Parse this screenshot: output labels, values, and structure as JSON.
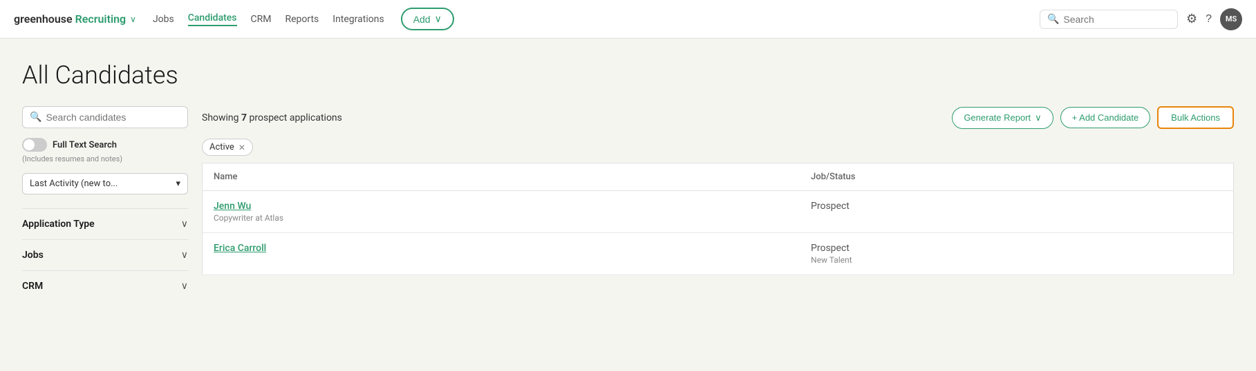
{
  "brand": {
    "greenhouse": "greenhouse",
    "recruiting": "Recruiting",
    "chevron": "∨"
  },
  "nav": {
    "links": [
      {
        "label": "Jobs",
        "active": false
      },
      {
        "label": "Candidates",
        "active": true
      },
      {
        "label": "CRM",
        "active": false
      },
      {
        "label": "Reports",
        "active": false
      },
      {
        "label": "Integrations",
        "active": false
      }
    ],
    "add_label": "Add",
    "search_placeholder": "Search",
    "avatar_initials": "MS"
  },
  "page": {
    "title": "All Candidates"
  },
  "sidebar": {
    "search_placeholder": "Search candidates",
    "full_text_label": "Full Text Search",
    "full_text_sub": "(Includes resumes and notes)",
    "sort_label": "Last Activity (new to...",
    "filters": [
      {
        "label": "Application Type"
      },
      {
        "label": "Jobs"
      },
      {
        "label": "CRM"
      }
    ]
  },
  "main": {
    "showing_prefix": "Showing ",
    "showing_count": "7",
    "showing_suffix": " prospect applications",
    "generate_report_label": "Generate Report",
    "add_candidate_label": "+ Add Candidate",
    "bulk_actions_label": "Bulk Actions",
    "active_filter_label": "Active",
    "table": {
      "col_name": "Name",
      "col_job_status": "Job/Status",
      "rows": [
        {
          "name": "Jenn Wu",
          "sub": "Copywriter at Atlas",
          "status": "Prospect",
          "status_sub": ""
        },
        {
          "name": "Erica Carroll",
          "sub": "",
          "status": "Prospect",
          "status_sub": "New Talent"
        }
      ]
    }
  }
}
